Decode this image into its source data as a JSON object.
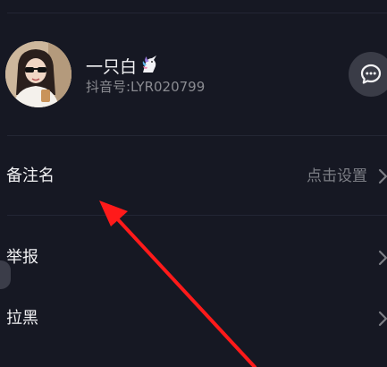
{
  "profile": {
    "nickname": "一只白",
    "douyin_id": "抖音号:LYR020799",
    "nickname_emoji": "unicorn-icon",
    "chat_icon": "chat-bubble-icon"
  },
  "rows": [
    {
      "label": "备注名",
      "value": "点击设置"
    },
    {
      "label": "举报"
    },
    {
      "label": "拉黑"
    }
  ],
  "colors": {
    "background": "#161823",
    "divider": "#232634",
    "primary_text": "#f1f1f3",
    "secondary_text": "#8a8b91",
    "annotation_arrow": "#ff1a1a"
  }
}
